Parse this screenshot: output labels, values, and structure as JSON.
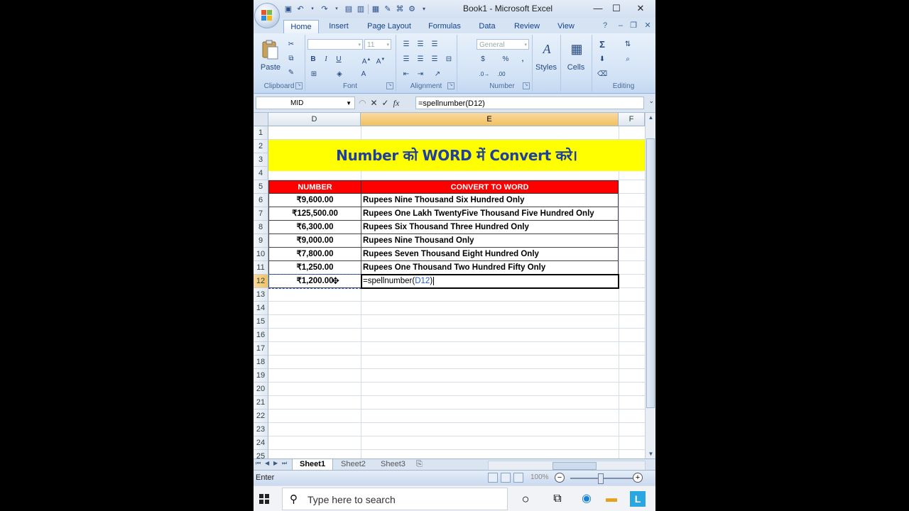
{
  "window": {
    "title": "Book1 - Microsoft Excel",
    "min": "—",
    "max": "☐",
    "close": "✕"
  },
  "tabs": [
    "Home",
    "Insert",
    "Page Layout",
    "Formulas",
    "Data",
    "Review",
    "View"
  ],
  "ribbon": {
    "clipboard": {
      "label": "Clipboard",
      "paste": "Paste"
    },
    "font": {
      "label": "Font",
      "font_size": "11",
      "bold": "B",
      "italic": "I",
      "underline": "U"
    },
    "alignment": {
      "label": "Alignment"
    },
    "number": {
      "label": "Number",
      "format": "General",
      "currency": "$",
      "percent": "%",
      "comma": ","
    },
    "styles": {
      "label": "Styles"
    },
    "cells": {
      "label": "Cells"
    },
    "editing": {
      "label": "Editing",
      "sum": "Σ"
    }
  },
  "formula_bar": {
    "name_box": "MID",
    "cancel": "✕",
    "enter": "✓",
    "fx": "fx",
    "formula": "=spellnumber(D12)"
  },
  "columns": [
    "D",
    "E",
    "F"
  ],
  "rows": [
    "1",
    "2",
    "3",
    "4",
    "5",
    "6",
    "7",
    "8",
    "9",
    "10",
    "11",
    "12",
    "13",
    "14",
    "15",
    "16",
    "17",
    "18",
    "19",
    "20",
    "21",
    "22",
    "23",
    "24",
    "25"
  ],
  "banner": "Number को WORD  में Convert करे।",
  "table": {
    "headers": [
      "NUMBER",
      "CONVERT TO WORD"
    ],
    "rows": [
      {
        "number": "₹9,600.00",
        "words": "Rupees Nine Thousand Six Hundred  Only"
      },
      {
        "number": "₹125,500.00",
        "words": "Rupees One Lakh TwentyFive Thousand Five Hundred  Only"
      },
      {
        "number": "₹6,300.00",
        "words": "Rupees Six Thousand Three Hundred  Only"
      },
      {
        "number": "₹9,000.00",
        "words": "Rupees Nine Thousand  Only"
      },
      {
        "number": "₹7,800.00",
        "words": "Rupees Seven Thousand Eight Hundred  Only"
      },
      {
        "number": "₹1,250.00",
        "words": "Rupees One Thousand Two Hundred Fifty Only"
      }
    ],
    "edit_row": {
      "number": "₹1,200.00",
      "formula_prefix": "=spellnumber(",
      "formula_ref": "D12",
      "formula_suffix": ")"
    }
  },
  "sheets": [
    "Sheet1",
    "Sheet2",
    "Sheet3"
  ],
  "status": {
    "mode": "Enter",
    "zoom": "100%"
  },
  "taskbar": {
    "search_placeholder": "Type here to search"
  },
  "colors": {
    "banner_bg": "#ffff00",
    "banner_text": "#1f3fa0",
    "header_bg": "#ff0000",
    "ref_blue": "#1f5ad1"
  }
}
